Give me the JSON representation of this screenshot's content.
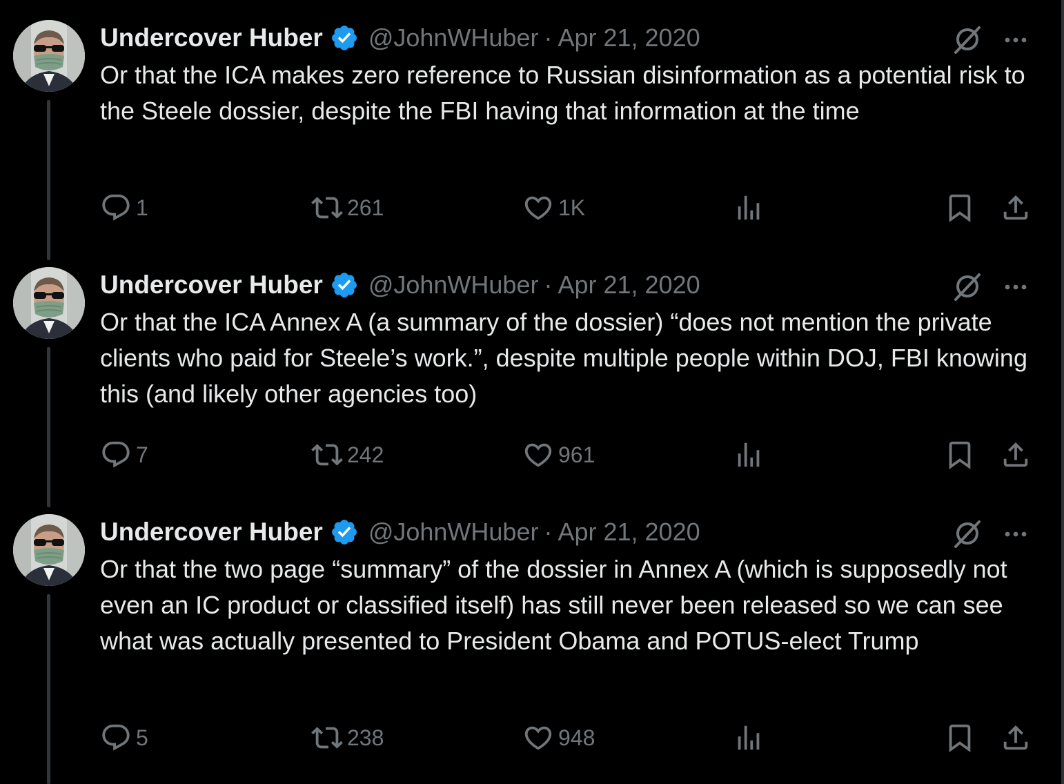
{
  "tweets": [
    {
      "author_name": "Undercover Huber",
      "handle": "@JohnWHuber",
      "separator": "·",
      "date": "Apr 21, 2020",
      "text": "Or that the ICA makes zero reference to Russian disinformation as a potential risk to the Steele dossier, despite the FBI having that information at the time",
      "replies": "1",
      "retweets": "261",
      "likes": "1K"
    },
    {
      "author_name": "Undercover Huber",
      "handle": "@JohnWHuber",
      "separator": "·",
      "date": "Apr 21, 2020",
      "text": "Or that the ICA Annex A (a summary of the dossier) “does not mention the private clients who paid for Steele’s work.”, despite multiple people within DOJ, FBI knowing this (and likely other agencies too)",
      "replies": "7",
      "retweets": "242",
      "likes": "961"
    },
    {
      "author_name": "Undercover Huber",
      "handle": "@JohnWHuber",
      "separator": "·",
      "date": "Apr 21, 2020",
      "text": "Or that the two page “summary” of the dossier in Annex A (which is supposedly not even an IC product or classified itself) has still never been released so we can see what was actually presented to President Obama and POTUS-elect Trump",
      "replies": "5",
      "retweets": "238",
      "likes": "948"
    }
  ],
  "colors": {
    "background": "#000000",
    "text": "#e7e9ea",
    "muted": "#71767b",
    "verified": "#1d9bf0",
    "thread_line": "#333639"
  },
  "icons": [
    "verified-badge-icon",
    "grok-icon",
    "more-icon",
    "reply-icon",
    "retweet-icon",
    "like-icon",
    "views-icon",
    "bookmark-icon",
    "share-icon"
  ]
}
